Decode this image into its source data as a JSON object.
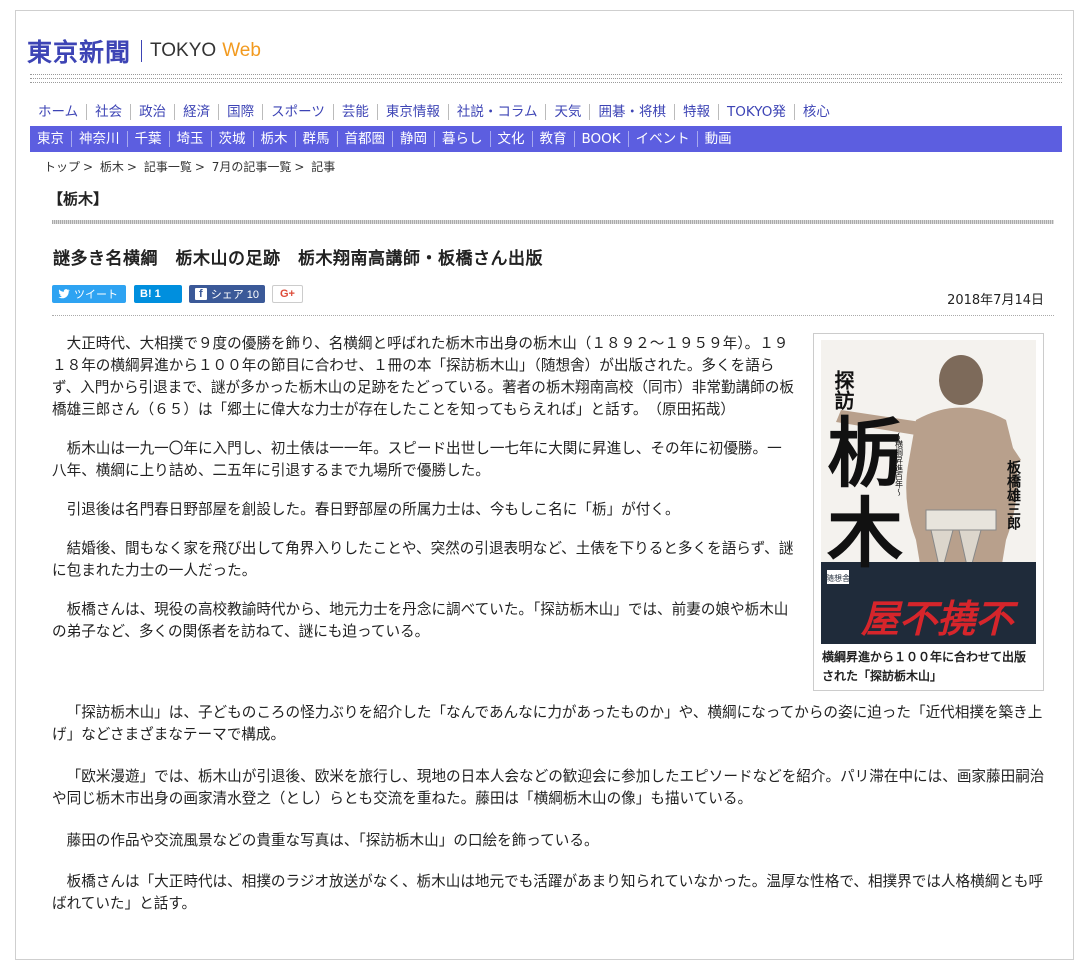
{
  "logo": {
    "jp": "東京新聞",
    "tokyo": "TOKYO",
    "web": "Web"
  },
  "nav_primary": [
    "ホーム",
    "社会",
    "政治",
    "経済",
    "国際",
    "スポーツ",
    "芸能",
    "東京情報",
    "社説・コラム",
    "天気",
    "囲碁・将棋",
    "特報",
    "TOKYO発",
    "核心"
  ],
  "nav_regional": [
    "東京",
    "神奈川",
    "千葉",
    "埼玉",
    "茨城",
    "栃木",
    "群馬",
    "首都圏",
    "静岡",
    "暮らし",
    "文化",
    "教育",
    "BOOK",
    "イベント",
    "動画"
  ],
  "breadcrumb": [
    "トップ",
    "栃木",
    "記事一覧",
    "7月の記事一覧",
    "記事"
  ],
  "breadcrumb_sep": ">",
  "section_label": "【栃木】",
  "headline": "謎多き名横綱　栃木山の足跡　栃木翔南高講師・板橋さん出版",
  "share": {
    "tweet": "ツイート",
    "hatena": "B! 1",
    "facebook": "シェア 10",
    "gplus": "G+"
  },
  "date": "2018年7月14日",
  "figure": {
    "title_small": "探訪",
    "title_big_1": "栃",
    "title_big_2": "木",
    "subtitle": "〜横綱昇進百年〜",
    "author": "板橋雄三郎",
    "publisher": "随想舎",
    "overlay": "屋不撓不",
    "caption": "横綱昇進から１００年に合わせて出版された「探訪栃木山」"
  },
  "article": [
    "大正時代、大相撲で９度の優勝を飾り、名横綱と呼ばれた栃木市出身の栃木山（１８９２〜１９５９年）。１９１８年の横綱昇進から１００年の節目に合わせ、１冊の本「探訪栃木山」（随想舎）が出版された。多くを語らず、入門から引退まで、謎が多かった栃木山の足跡をたどっている。著者の栃木翔南高校（同市）非常勤講師の板橋雄三郎さん（６５）は「郷土に偉大な力士が存在したことを知ってもらえれば」と話す。　（原田拓哉）",
    "栃木山は一九一〇年に入門し、初土俵は一一年。スピード出世し一七年に大関に昇進し、その年に初優勝。一八年、横綱に上り詰め、二五年に引退するまで九場所で優勝した。",
    "引退後は名門春日野部屋を創設した。春日野部屋の所属力士は、今もしこ名に「栃」が付く。",
    "結婚後、間もなく家を飛び出して角界入りしたことや、突然の引退表明など、土俵を下りると多くを語らず、謎に包まれた力士の一人だった。",
    "板橋さんは、現役の高校教諭時代から、地元力士を丹念に調べていた。「探訪栃木山」では、前妻の娘や栃木山の弟子など、多くの関係者を訪ねて、謎にも迫っている。",
    "「探訪栃木山」は、子どものころの怪力ぶりを紹介した「なんであんなに力があったものか」や、横綱になってからの姿に迫った「近代相撲を築き上げ」などさまざまなテーマで構成。",
    "「欧米漫遊」では、栃木山が引退後、欧米を旅行し、現地の日本人会などの歓迎会に参加したエピソードなどを紹介。パリ滞在中には、画家藤田嗣治や同じ栃木市出身の画家清水登之（とし）らとも交流を重ねた。藤田は「横綱栃木山の像」も描いている。",
    "藤田の作品や交流風景などの貴重な写真は、「探訪栃木山」の口絵を飾っている。",
    "板橋さんは「大正時代は、相撲のラジオ放送がなく、栃木山は地元でも活躍があまり知られていなかった。温厚な性格で、相撲界では人格横綱とも呼ばれていた」と話す。"
  ],
  "colors": {
    "brand_blue": "#3d44b5",
    "nav_bar": "#5c5ee0",
    "web_orange": "#f29a1f"
  }
}
